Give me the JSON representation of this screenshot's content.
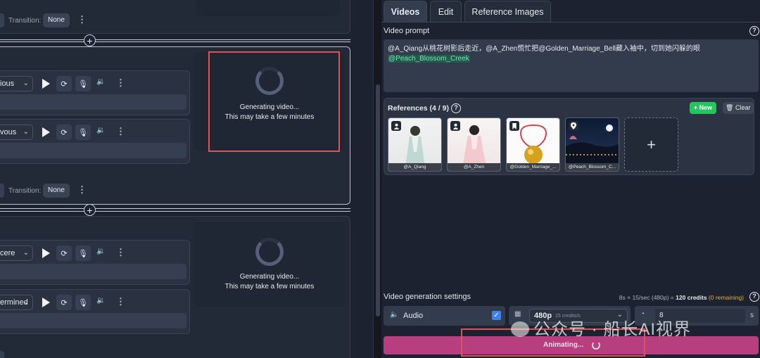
{
  "left": {
    "top_transition_label": "Transition:",
    "top_transition_value": "None",
    "scene1": {
      "row1_select": "ious",
      "row2_select": "vous",
      "transition_label": "Transition:",
      "transition_value": "None",
      "gen_line1": "Generating video...",
      "gen_line2": "This may take a few minutes"
    },
    "scene2": {
      "row1_select": "cere",
      "row2_select": "ermined",
      "gen_line1": "Generating video...",
      "gen_line2": "This may take a few minutes"
    }
  },
  "tabs": [
    {
      "label": "Videos",
      "active": true
    },
    {
      "label": "Edit",
      "active": false
    },
    {
      "label": "Reference Images",
      "active": false
    }
  ],
  "prompt": {
    "label": "Video prompt",
    "text_line1": "@A_Qiang从桃花树影后走近，@A_Zhen慌忙把@Golden_Marriage_Bell藏入袖中，切到她闪躲的眼",
    "text_line2": "@Peach_Blossom_Creek"
  },
  "references": {
    "title": "References (4 / 9)",
    "new_label": "+ New",
    "clear_label": "Clear",
    "items": [
      {
        "caption": "@A_Qiang",
        "badge_icon": "person-icon"
      },
      {
        "caption": "@A_Zhen",
        "badge_icon": "person-icon"
      },
      {
        "caption": "@Golden_Marriage_...",
        "badge_icon": "bookmark-icon"
      },
      {
        "caption": "@Peach_Blossom_C...",
        "badge_icon": "location-pin-icon"
      }
    ],
    "add_label": "+"
  },
  "settings": {
    "label": "Video generation settings",
    "cost_prefix": "8s × 15/sec (480p) = ",
    "cost_credits": "120 credits",
    "cost_remaining": "(0 remaining)",
    "audio_label": "Audio",
    "audio_checked": true,
    "resolution": "480p",
    "resolution_sub": "15 credits/s",
    "duration": "8",
    "duration_unit": "s",
    "animate_label": "Animating..."
  },
  "watermark": "公众号 · 船长AI视界",
  "colors": {
    "accent_green": "#22c55e",
    "animate_button": "#b83f7f",
    "highlight_red": "#e05255",
    "checkbox_blue": "#3b82f6",
    "mention_bg": "#1f5c4a",
    "remaining_yellow": "#e0b12e"
  }
}
